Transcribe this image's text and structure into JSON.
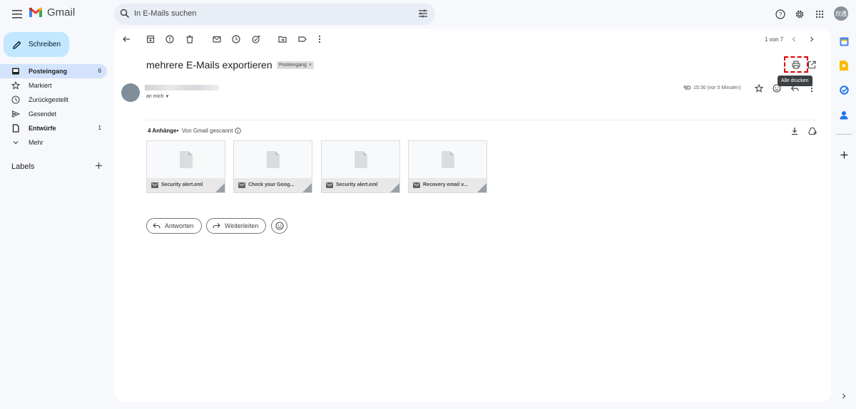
{
  "app": {
    "name": "Gmail",
    "search_placeholder": "In E-Mails suchen",
    "avatar_text": "欣遇"
  },
  "sidebar": {
    "compose_label": "Schreiben",
    "items": [
      {
        "label": "Posteingang",
        "icon": "inbox-icon",
        "count": "6",
        "active": true,
        "bold": true
      },
      {
        "label": "Markiert",
        "icon": "star-icon",
        "count": "",
        "active": false,
        "bold": false
      },
      {
        "label": "Zurückgestellt",
        "icon": "clock-icon",
        "count": "",
        "active": false,
        "bold": false
      },
      {
        "label": "Gesendet",
        "icon": "send-icon",
        "count": "",
        "active": false,
        "bold": false
      },
      {
        "label": "Entwürfe",
        "icon": "draft-icon",
        "count": "1",
        "active": false,
        "bold": true
      },
      {
        "label": "Mehr",
        "icon": "chevron-down-icon",
        "count": "",
        "active": false,
        "bold": false
      }
    ],
    "labels_title": "Labels"
  },
  "toolbar": {
    "pager_text": "1 von 7",
    "icons": [
      "back-icon",
      "archive-icon",
      "report-spam-icon",
      "delete-icon",
      "mark-unread-icon",
      "snooze-icon",
      "add-task-icon",
      "move-to-icon",
      "label-icon",
      "more-icon"
    ]
  },
  "message": {
    "subject": "mehrere E-Mails exportieren",
    "label_chip": "Posteingang",
    "recipient": "an mich",
    "timestamp": "15:30 (vor 0 Minuten)",
    "print_tooltip": "Alle drucken",
    "attachments_title": "4 Anhänge",
    "attachments_scanned": "Von Gmail gescannt",
    "attachments": [
      {
        "name": "Security alert.eml"
      },
      {
        "name": "Check your Goog..."
      },
      {
        "name": "Security alert.eml"
      },
      {
        "name": "Recovery email v..."
      }
    ],
    "reply_label": "Antworten",
    "forward_label": "Weiterleiten"
  },
  "colors": {
    "background": "#f6f8fc",
    "compose": "#c2e7ff",
    "active_nav": "#d3e3fd",
    "highlight_box": "#e00000"
  }
}
